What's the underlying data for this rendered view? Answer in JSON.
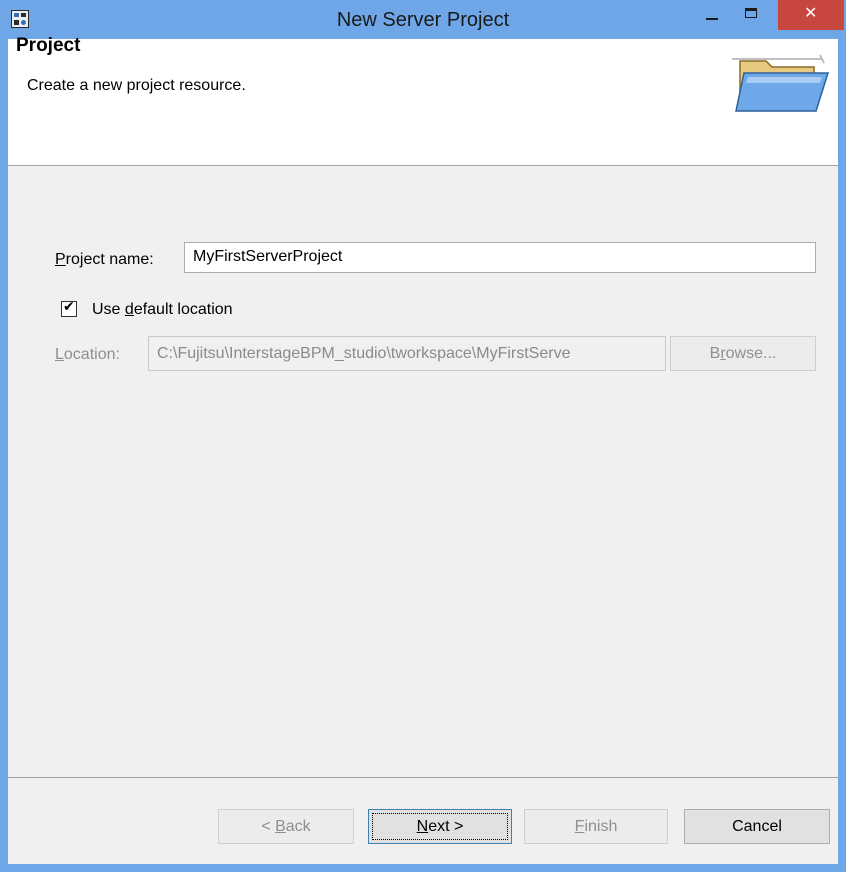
{
  "window": {
    "title": "New Server Project",
    "close_glyph": "✕",
    "app_icon": "wizard-app-icon"
  },
  "header": {
    "title": "Project",
    "description": "Create a new project resource.",
    "icon": "open-folder-icon"
  },
  "form": {
    "project_name_label_mnemonic": "P",
    "project_name_label_rest": "roject name:",
    "project_name_value": "MyFirstServerProject",
    "use_default_prefix": "Use ",
    "use_default_mnemonic": "d",
    "use_default_rest": "efault location",
    "use_default_checked": true,
    "check_glyph": "✔",
    "location_label_mnemonic": "L",
    "location_label_rest": "ocation:",
    "location_value": "C:\\Fujitsu\\InterstageBPM_studio\\tworkspace\\MyFirstServe",
    "browse_prefix": "B",
    "browse_mnemonic": "r",
    "browse_rest": "owse..."
  },
  "footer": {
    "back_prefix": "< ",
    "back_mnemonic": "B",
    "back_rest": "ack",
    "next_mnemonic": "N",
    "next_rest": "ext >",
    "finish_mnemonic": "F",
    "finish_rest": "inish",
    "cancel_label": "Cancel"
  },
  "colors": {
    "titlebar": "#6ea6e8",
    "close_button": "#c7473f",
    "dialog_background": "#f0f0f0"
  }
}
